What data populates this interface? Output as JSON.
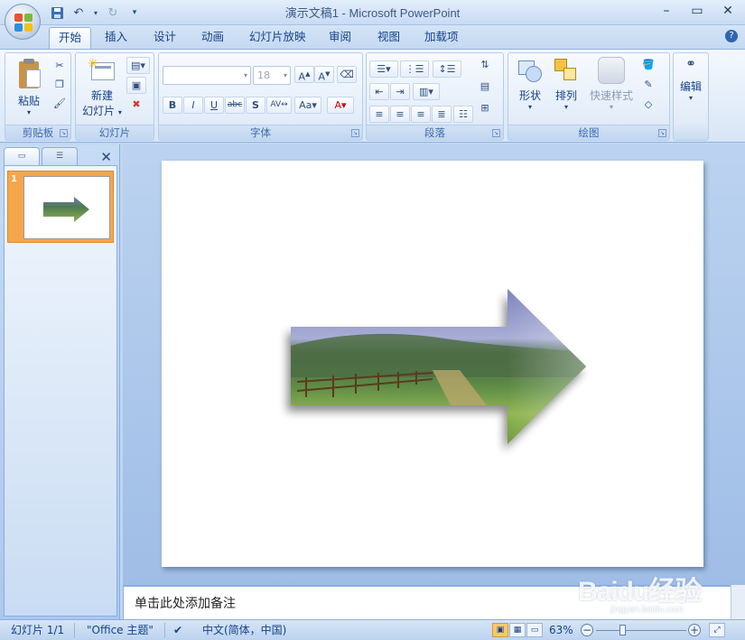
{
  "app": {
    "title": "演示文稿1 - Microsoft PowerPoint"
  },
  "tabs": [
    {
      "label": "开始",
      "active": true
    },
    {
      "label": "插入"
    },
    {
      "label": "设计"
    },
    {
      "label": "动画"
    },
    {
      "label": "幻灯片放映"
    },
    {
      "label": "审阅"
    },
    {
      "label": "视图"
    },
    {
      "label": "加载项"
    }
  ],
  "ribbon": {
    "clipboard": {
      "paste_label": "粘贴",
      "group_label": "剪贴板"
    },
    "slides": {
      "new_slide_line1": "新建",
      "new_slide_line2": "幻灯片",
      "group_label": "幻灯片"
    },
    "font": {
      "font_size": "18",
      "group_label": "字体"
    },
    "paragraph": {
      "group_label": "段落"
    },
    "drawing": {
      "shapes_label": "形状",
      "arrange_label": "排列",
      "quick_styles_label": "快速样式",
      "group_label": "绘图"
    },
    "editing": {
      "label": "编辑"
    }
  },
  "slides_pane": {
    "slide_number": "1"
  },
  "notes": {
    "placeholder": "单击此处添加备注"
  },
  "statusbar": {
    "slide_info": "幻灯片 1/1",
    "theme": "\"Office 主题\"",
    "language": "中文(简体，中国)",
    "zoom": "63%"
  },
  "watermark": {
    "brand": "Baidu经验",
    "url": "jingyan.baidu.com"
  },
  "colors": {
    "accent": "#15428b",
    "selected_thumb": "#f6a64a"
  }
}
